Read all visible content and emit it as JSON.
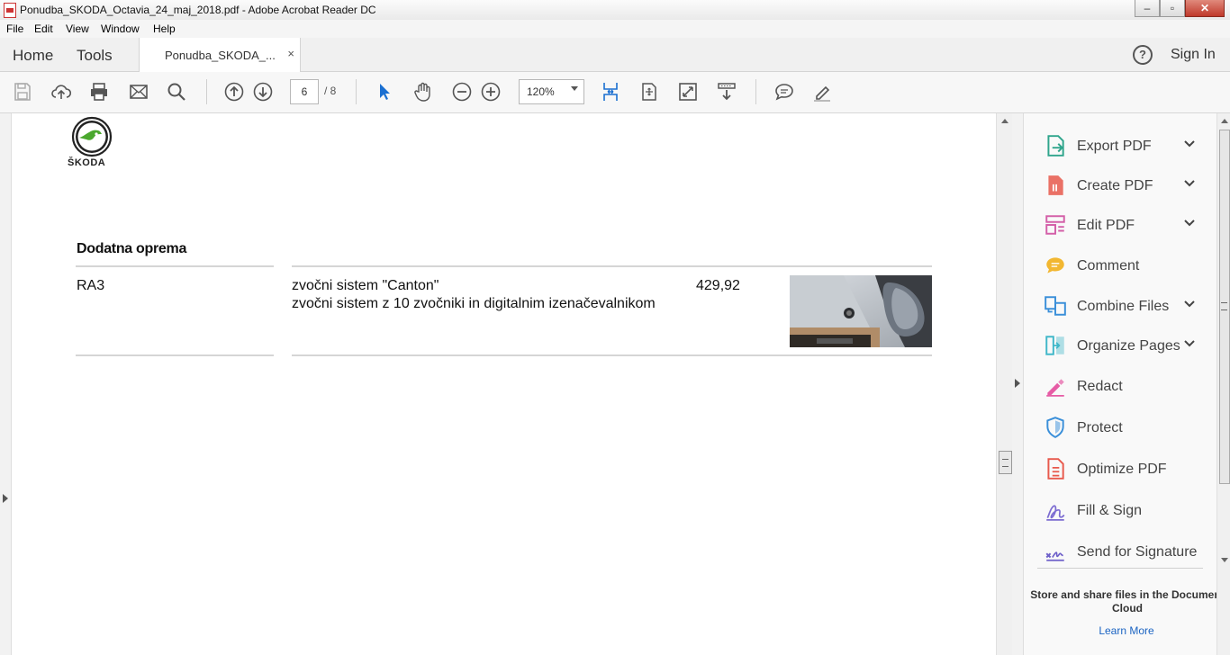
{
  "window": {
    "title": "Ponudba_SKODA_Octavia_24_maj_2018.pdf - Adobe Acrobat Reader DC"
  },
  "menu": [
    "File",
    "Edit",
    "View",
    "Window",
    "Help"
  ],
  "nav": {
    "home": "Home",
    "tools": "Tools",
    "doc_tab": "Ponudba_SKODA_...",
    "tab_close": "×",
    "sign_in": "Sign In",
    "help": "?"
  },
  "toolbar": {
    "page_current": "6",
    "page_total": "/ 8",
    "zoom": "120%"
  },
  "document": {
    "brand": "ŠKODA",
    "section_title": "Dodatna oprema",
    "item": {
      "code": "RA3",
      "name": "zvočni sistem \"Canton\"",
      "description": "zvočni sistem z 10 zvočniki in digitalnim izenačevalnikom",
      "price": "429,92"
    }
  },
  "tools_pane": {
    "items": [
      {
        "label": "Export PDF",
        "icon": "export-pdf-icon",
        "color": "#2fa58c",
        "chevron": true
      },
      {
        "label": "Create PDF",
        "icon": "create-pdf-icon",
        "color": "#e8594c",
        "chevron": true
      },
      {
        "label": "Edit PDF",
        "icon": "edit-pdf-icon",
        "color": "#d35fa8",
        "chevron": true
      },
      {
        "label": "Comment",
        "icon": "comment-icon",
        "color": "#f2b731",
        "chevron": false
      },
      {
        "label": "Combine Files",
        "icon": "combine-files-icon",
        "color": "#3a8fd9",
        "chevron": true
      },
      {
        "label": "Organize Pages",
        "icon": "organize-pages-icon",
        "color": "#3fb7c9",
        "chevron": true
      },
      {
        "label": "Redact",
        "icon": "redact-icon",
        "color": "#e65ca5",
        "chevron": false
      },
      {
        "label": "Protect",
        "icon": "protect-icon",
        "color": "#3a8fd9",
        "chevron": false
      },
      {
        "label": "Optimize PDF",
        "icon": "optimize-pdf-icon",
        "color": "#e8594c",
        "chevron": false
      },
      {
        "label": "Fill & Sign",
        "icon": "fill-sign-icon",
        "color": "#7c6cd1",
        "chevron": false
      },
      {
        "label": "Send for Signature",
        "icon": "send-signature-icon",
        "color": "#6d5fc9",
        "chevron": false
      }
    ],
    "cloud_text": "Store and share files in the Document Cloud",
    "learn_more": "Learn More"
  }
}
